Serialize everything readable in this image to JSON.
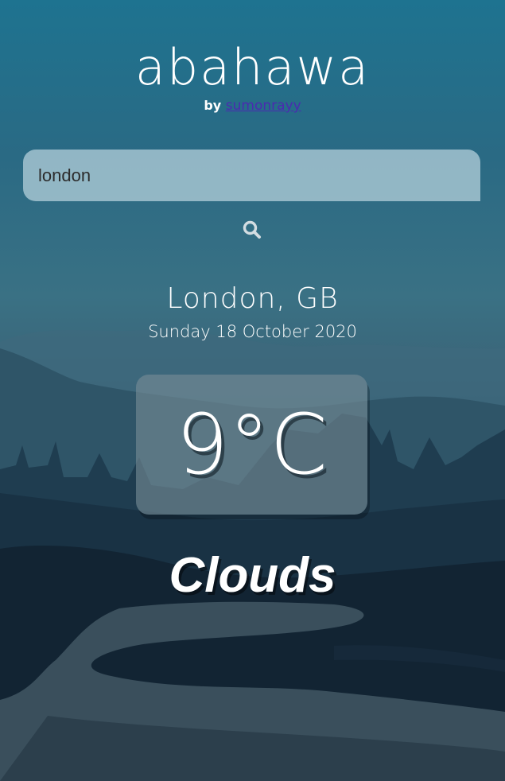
{
  "app": {
    "title": "abahawa",
    "by_label": "by",
    "author": "sumonrayy"
  },
  "search": {
    "value": "london"
  },
  "icons": {
    "search": "search-icon"
  },
  "weather": {
    "location": "London, GB",
    "date": "Sunday 18 October 2020",
    "temperature": "9°C",
    "condition": "Clouds"
  },
  "colors": {
    "sky_top": "#1e7390",
    "link": "#4a2bb0",
    "text": "#ffffff"
  }
}
